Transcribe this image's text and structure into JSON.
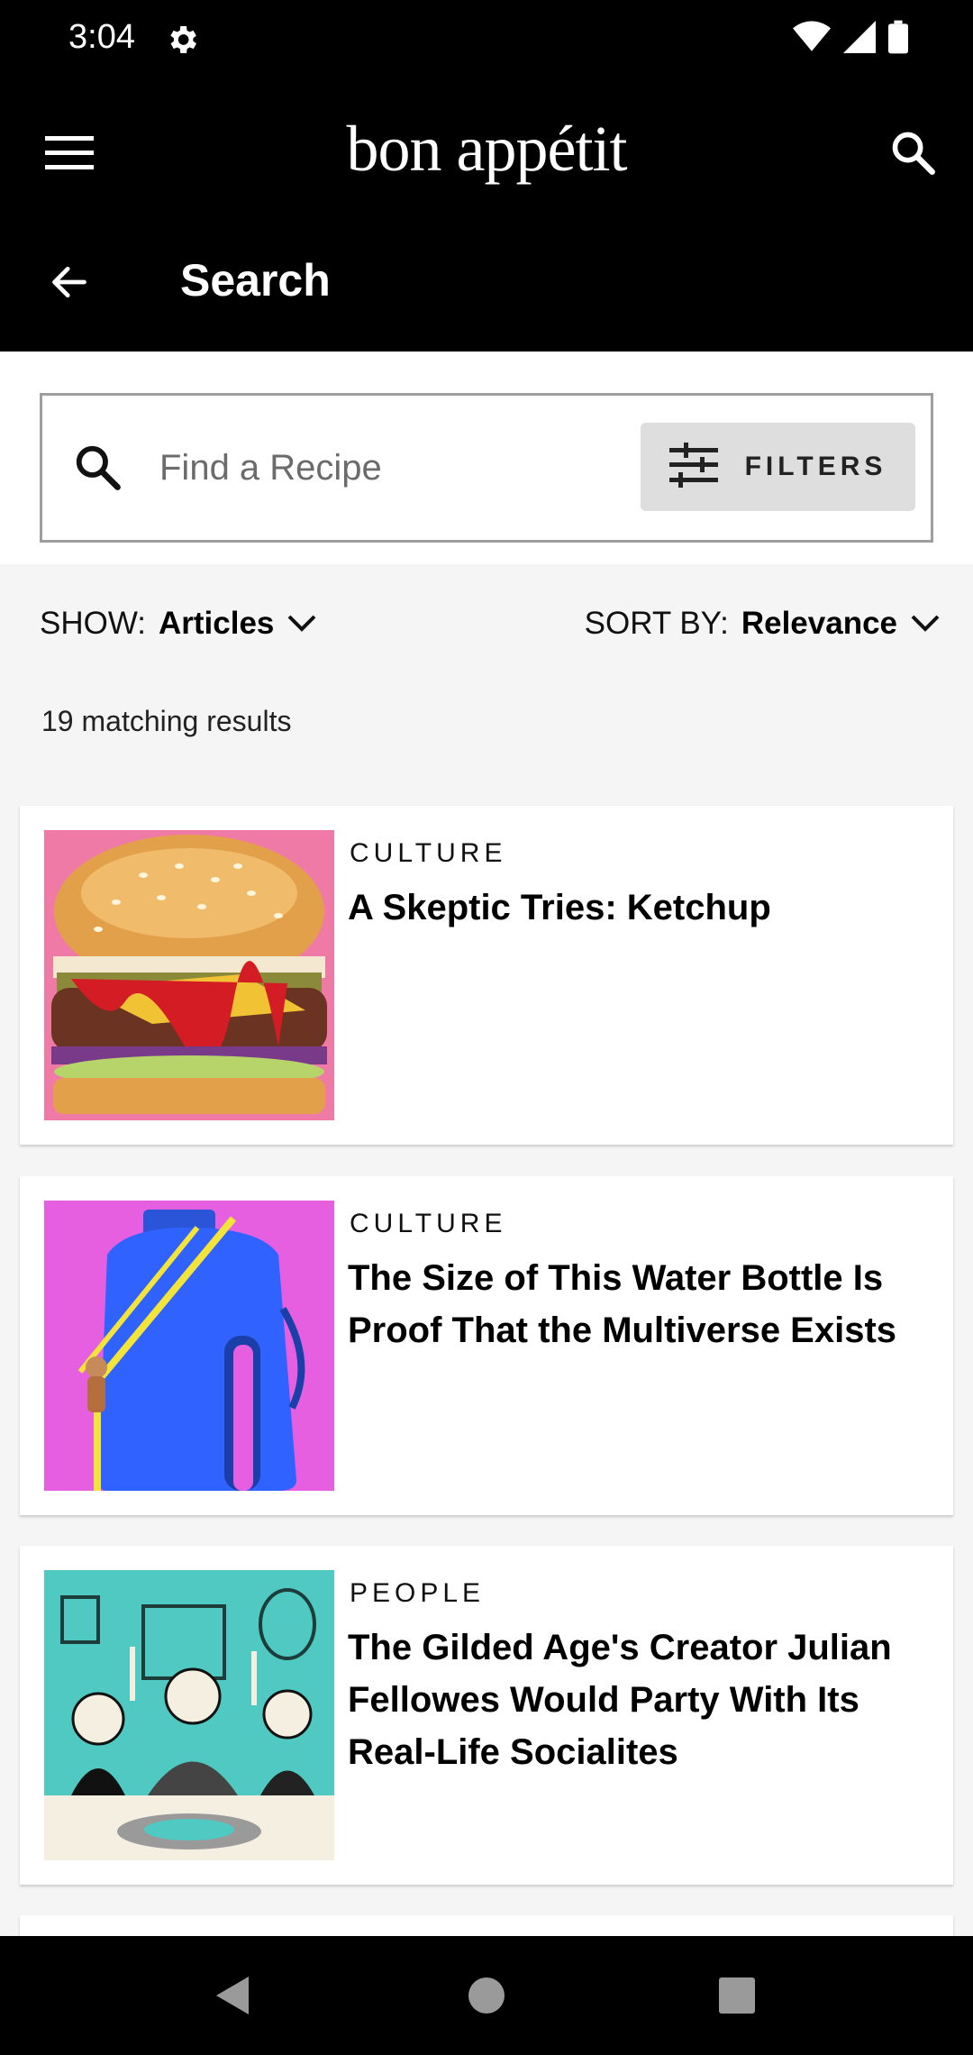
{
  "status_bar": {
    "time": "3:04",
    "icons": [
      "gear-icon",
      "wifi-icon",
      "signal-icon",
      "battery-icon"
    ]
  },
  "app_bar": {
    "brand": "bon appétit",
    "page_title": "Search",
    "icons": [
      "menu-icon",
      "search-icon",
      "back-arrow-icon"
    ]
  },
  "search": {
    "placeholder": "Find a Recipe",
    "value": "",
    "filters_label": "FILTERS"
  },
  "controls": {
    "show_label": "SHOW:",
    "show_value": "Articles",
    "sort_label": "SORT BY:",
    "sort_value": "Relevance"
  },
  "results": {
    "count_text": "19 matching results",
    "items": [
      {
        "category": "CULTURE",
        "title": "A Skeptic Tries: Ketchup",
        "image": "burger-with-ketchup"
      },
      {
        "category": "CULTURE",
        "title": "The Size of This Water Bottle Is Proof That the Multiverse Exists",
        "image": "giant-blue-water-bottle"
      },
      {
        "category": "PEOPLE",
        "title": "The Gilded Age's Creator Julian Fellowes Would Party With Its Real-Life Socialites",
        "image": "gilded-age-dinner-party-illustration"
      }
    ]
  },
  "colors": {
    "app_bar": "#000000",
    "background": "#f5f5f5",
    "card": "#ffffff",
    "filters_button": "#dedede"
  }
}
